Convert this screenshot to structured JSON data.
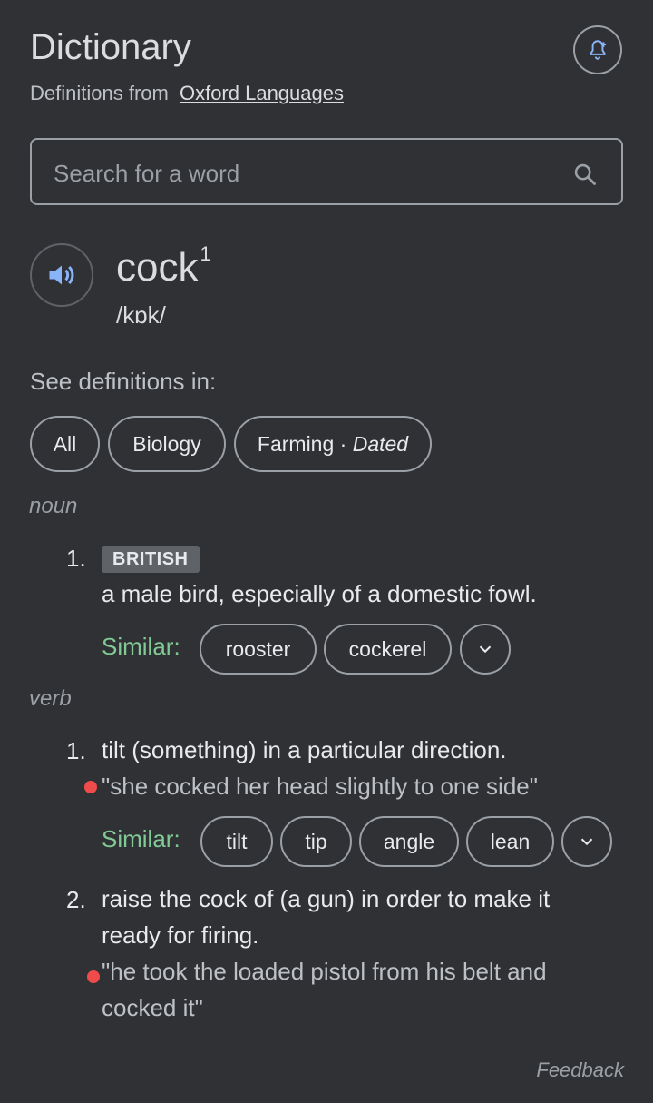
{
  "header": {
    "title": "Dictionary",
    "subtitle_prefix": "Definitions from",
    "source_link": "Oxford Languages",
    "alert_icon": "bell-plus-icon"
  },
  "search": {
    "placeholder": "Search for a word",
    "icon": "search-icon"
  },
  "entry": {
    "word": "cock",
    "superscript": "1",
    "phonetic": "/kɒk/",
    "audio_icon": "speaker-icon",
    "audio_color": "#8ab4f8"
  },
  "filters": {
    "label": "See definitions in:",
    "chips": [
      {
        "label": "All"
      },
      {
        "label": "Biology"
      },
      {
        "label": "Farming · ",
        "tag": "Dated"
      }
    ]
  },
  "noun": {
    "pos": "noun",
    "senses": [
      {
        "number": "1.",
        "region": "BRITISH",
        "definition": "a male bird, especially of a domestic fowl.",
        "similar_label": "Similar:",
        "similar": [
          "rooster",
          "cockerel"
        ]
      }
    ]
  },
  "verb": {
    "pos": "verb",
    "senses": [
      {
        "number": "1.",
        "definition": "tilt (something) in a particular direction.",
        "example": "\"she cocked her head slightly to one side\"",
        "similar_label": "Similar:",
        "similar": [
          "tilt",
          "tip",
          "angle",
          "lean"
        ]
      },
      {
        "number": "2.",
        "definition_line1": "raise the cock of (a gun) in order to make it",
        "definition_line2": "ready for firing.",
        "example_line1": "\"he took the loaded pistol from his belt and",
        "example_line2": "cocked it\""
      }
    ]
  },
  "footer": {
    "feedback": "Feedback"
  },
  "colors": {
    "background": "#303134",
    "similar_label": "#81c995",
    "example_dot": "#f04b4b"
  }
}
